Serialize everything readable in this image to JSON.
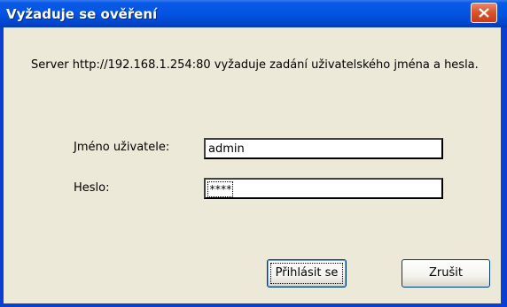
{
  "window": {
    "title": "Vyžaduje se ověření"
  },
  "message": "Server http://192.168.1.254:80 vyžaduje zadání uživatelského jména a hesla.",
  "form": {
    "username_label": "Jméno uživatele:",
    "username_value": "admin",
    "password_label": "Heslo:",
    "password_mask": "****"
  },
  "buttons": {
    "login_label": "Přihlásit se",
    "cancel_label": "Zrušit"
  },
  "icons": {
    "close": "close-icon"
  },
  "colors": {
    "titlebar": "#0454e2",
    "client_bg": "#ece9d8",
    "close_button": "#d9562e"
  }
}
